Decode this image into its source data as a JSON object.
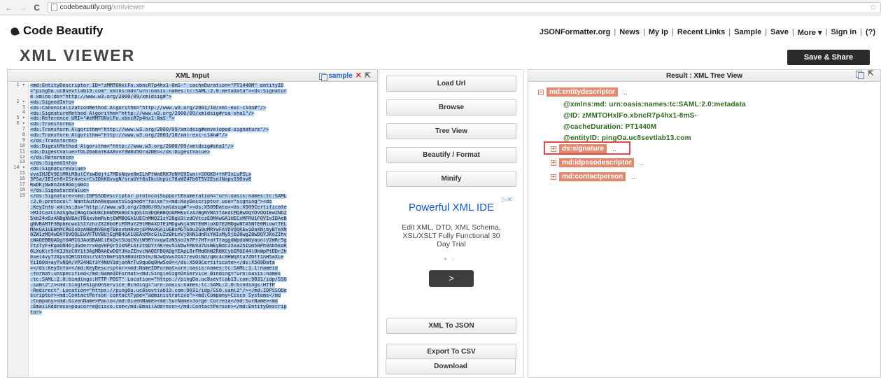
{
  "browser": {
    "url_host": "codebeautify.org",
    "url_path": "/xmlviewer"
  },
  "header": {
    "logo_text": "Code Beautify",
    "nav": [
      "JSONFormatter.org",
      "News",
      "My Ip",
      "Recent Links",
      "Sample",
      "Save",
      "More ▾",
      "Sign in",
      "(?)"
    ]
  },
  "page": {
    "title": "XML VIEWER",
    "share_button": "Save & Share"
  },
  "input_panel": {
    "title": "XML Input",
    "sample_label": "sample",
    "close_label": "✕",
    "line_numbers": [
      "1 ▾",
      "",
      "",
      "2 ▾",
      "3",
      "4",
      "5 ▾",
      "6 ▾",
      "7",
      "8",
      "9",
      "10",
      "11",
      "12",
      "13",
      "14 ▾",
      "15",
      "16",
      "17",
      "18",
      "19",
      "",
      "",
      "",
      "",
      "",
      "",
      "",
      "",
      "",
      "",
      "",
      "",
      "",
      "",
      "",
      "",
      "",
      "",
      "",
      "",
      "",
      "",
      "",
      "",
      "",
      "",
      "",
      "",
      "",
      "",
      "",
      "",
      ""
    ],
    "code_lines": [
      "<md:EntityDescriptor ID=\"zMMTOHxlFo.xbncR7p4hx1-8mS-\" cacheDuration=\"PT1440M\" entityID",
      "=\"pingOa.uc8sevtlab13.com\" xmlns:md=\"urn:oasis:names:tc:SAML:2.0:metadata\"><ds:Signatur",
      "e xmlns:ds=\"http://www.w3.org/2000/09/xmldsig#\">",
      "<ds:SignedInfo>",
      "<ds:CanonicalizationMethod Algorithm=\"http://www.w3.org/2001/10/xml-exc-c14n#\"/>",
      "<ds:SignatureMethod Algorithm=\"http://www.w3.org/2000/09/xmldsig#rsa-sha1\"/>",
      "<ds:Reference URI=\"#zMMTOHxlFo.xbncR7p4hx1-8mS-\">",
      "<ds:Transforms>",
      "<ds:Transform Algorithm=\"http://www.w3.org/2000/09/xmldsig#enveloped-signature\"/>",
      "<ds:Transform Algorithm=\"http://www.w3.org/2001/10/xml-exc-c14n#\"/>",
      "</ds:Transforms>",
      "<ds:DigestMethod Algorithm=\"http://www.w3.org/2000/09/xmldsig#sha1\"/>",
      "<ds:DigestValue>TOLZ6aEafK4A8vvY3W8U5Ora2NE=</ds:DigestValue>",
      "</ds:Reference>",
      "</ds:SignedInfo>",
      "<ds:SignatureValue>",
      "vvaIHJEV9ElMRlM8ulCYxwDdjfi7MDsNqve8mILhPfWa6RK7eNYQ9Iwal+SOGKD+fhPIxLuPSLx",
      "3PSa/IEIef8+ISr4vexrCsIDkKGvvgN/sraUYf6oIkcUnpic78vWZ4Tb6T5V2EsnJNapv19Onv8",
      "RwDKjNw8nZnK8GbjGB4=",
      "</ds:SignatureValue>",
      "</ds:Signature><md:IDPSSODescriptor protocolSupportEnumeration=\"urn:oasis:names:tc:SAML",
      ":2.0:protocol\" WantAuthnRequestsSigned=\"false\"><md:KeyDescriptor use=\"signing\"><ds",
      ":KeyInfo xmlns:ds=\"http://www.w3.org/2000/09/xmldsig#\"><ds:X509Data><ds:X509Certificate",
      ">MIICazCCAdSgAwIBAgIGAU8CbGW5MA0GCSqGSIb3DQEBBQUAMHkxCzAJBgNVBAYTAkdCMQ8wDQYDVQQIEwZNb2",
      "5kb24xDzANBgNVBAcTBkxvbmRvbjEWMBQGA1UEChMNQ21zY28gU3lzdGVtczEOMAwGA1UECxMFRU1FQVIxIDAeB",
      "gNVBAMTF3Bpbmcwx1SIYzhzZXZ0bGFiMTMuY29tMB4XDTE1MDgwNjA5NTE0MloXDTE2MDgwNTA5NTE0MlowfTEL",
      "MAkGA1UEBhMCR0IxDzANBgNVBAgTBkxvbmRvbjEPMA0GA1UEBxMGTG9uZG9uMRYwFAYDVQQKEw1DaXNjbyBTeXN",
      "0ZW1zMQ4wDAYDVQQLEwVFTUVBUjEgMB4GA1UEAxMXcGluZzBhLnVjOHN1dnRsYWIxMy5jb20wgZ8wDQYJKoZIhv",
      "cNAQEBBQADgY0AMIGJAoGBANClEkQvtSUqCKVlW9RYvxqwIzN5soJh7Pf7HT+afTfaggdWpdoWdyaonlV2mRr5g",
      "7tzTyF+KgaUN46j3Gderrx0gVHPQr5IkNPLAr2tbDYf4Krev51N5wFMk937UsWEyBdc2Xxa2hIUm58Ph9Ab5koR",
      "6LXuKlr5fKIJhzC0Y1t3AgMBAAEwDQYJKoZIhvcNAQEFBQADgYEApL8rFMd0hN2R8KCybIRUI44lOkWpPtDDrJh",
      "bsel4vyTZXpshQRtDtOnlrV45YNkP1Q53BUUrD5tk/NJwQVwsXIA7revOlNd/qWc4c0HWqXtu7ZDff1nH5aXLe",
      "YiI80d+ayTvNQA/VP24HEf3Y4NUV3djonNrTu9qu6q0Hw5o0=</ds:X509Certificate></ds:X509Data",
      "></ds:KeyInfo></md:KeyDescriptor><md:NameIDFormat>urn:oasis:names:tc:SAML:1.1:nameid",
      "-format:unspecified</md:NameIDFormat><md:SingleSignOnService Binding=\"urn:oasis:names",
      ":tc:SAML:2.0:bindings:HTTP-POST\" Location=\"https://pingOa.uc8sevtlab13.com:9031/idp/SSO",
      ".saml2\"/><md:SingleSignOnService Binding=\"urn:oasis:names:tc:SAML:2.0:bindings:HTTP",
      "-Redirect\" Location=\"https://pingOa.uc8sevtlab13.com:9031/idp/SSO.saml2\"/></md:IDPSSODe",
      "scriptor><md:ContactPerson contactType=\"administrative\"><md:Company>Cisco Systems</md",
      ":Company><md:GivenName>Paulo</md:GivenName><md:SurName>Jorge Correia</md:SurName><md",
      ":EmailAddress>paucorre@cisco.com</md:EmailAddress></md:ContactPerson></md:EntityDescrip",
      "tor>"
    ]
  },
  "actions": {
    "load_url": "Load Url",
    "browse": "Browse",
    "tree_view": "Tree View",
    "beautify": "Beautify / Format",
    "minify": "Minify",
    "xml_to_json": "XML To JSON",
    "export_csv": "Export To CSV",
    "download": "Download"
  },
  "ad": {
    "title": "Powerful XML IDE",
    "body": "Edit XML, DTD, XML Schema, XSL/XSLT Fully Functional 30 Day Trial",
    "arrow": ">"
  },
  "result_panel": {
    "title": "Result : XML Tree View",
    "root_tag": "md:entitydescriptor",
    "root_attrs": [
      "@xmlns:md: urn:oasis:names:tc:SAML:2.0:metadata",
      "@ID: zMMTOHxlFo.xbncR7p4hx1-8mS-",
      "@cacheDuration: PT1440M",
      "@entityID: pingOa.uc8sevtlab13.com"
    ],
    "children": [
      "ds:signature",
      "md:idpssodescriptor",
      "md:contactperson"
    ],
    "ellipsis": ".."
  }
}
